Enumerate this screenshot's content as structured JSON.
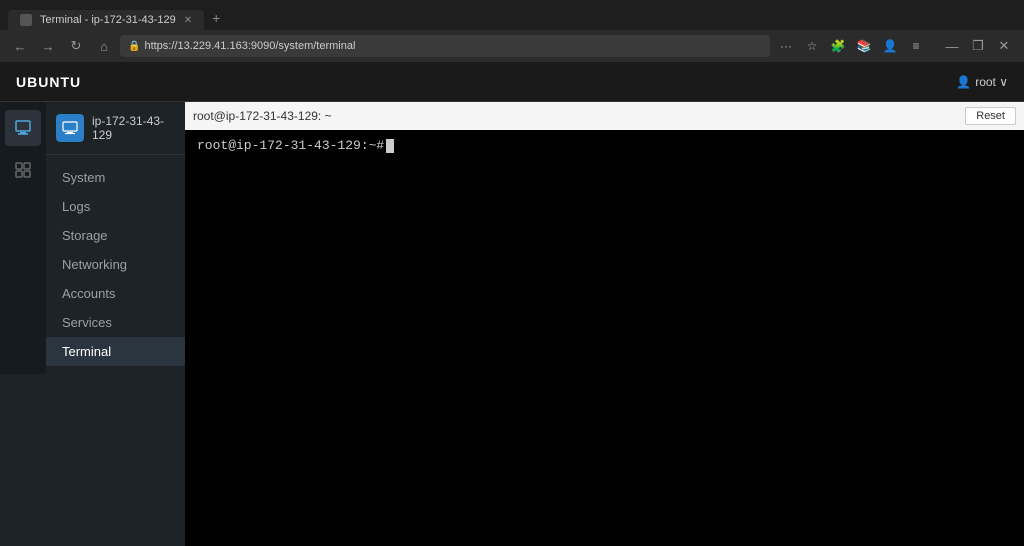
{
  "browser": {
    "tab_label": "Terminal - ip-172-31-43-129",
    "url": "https://13.229.41.163:9090/system/terminal",
    "new_tab_icon": "+",
    "back_icon": "←",
    "forward_icon": "→",
    "refresh_icon": "↻",
    "home_icon": "⌂",
    "lock_icon": "🔒",
    "more_icon": "···",
    "bookmark_icon": "☆",
    "extensions_icon": "🧩",
    "sidebar_icon": "📚",
    "menu_icon": "≡",
    "window_min": "—",
    "window_max": "❐",
    "window_close": "✕"
  },
  "app": {
    "brand": "UBUNTU",
    "user_menu": "root ∨"
  },
  "left_panel": {
    "device_name": "ip-172-31-43-129",
    "nav_items": [
      {
        "label": "System",
        "id": "system",
        "active": false
      },
      {
        "label": "Logs",
        "id": "logs",
        "active": false
      },
      {
        "label": "Storage",
        "id": "storage",
        "active": false
      },
      {
        "label": "Networking",
        "id": "networking",
        "active": false
      },
      {
        "label": "Accounts",
        "id": "accounts",
        "active": false
      },
      {
        "label": "Services",
        "id": "services",
        "active": false
      },
      {
        "label": "Terminal",
        "id": "terminal",
        "active": true
      }
    ]
  },
  "terminal": {
    "header_title": "root@ip-172-31-43-129: ~",
    "reset_button": "Reset",
    "prompt_line": "root@ip-172-31-43-129:~#"
  }
}
